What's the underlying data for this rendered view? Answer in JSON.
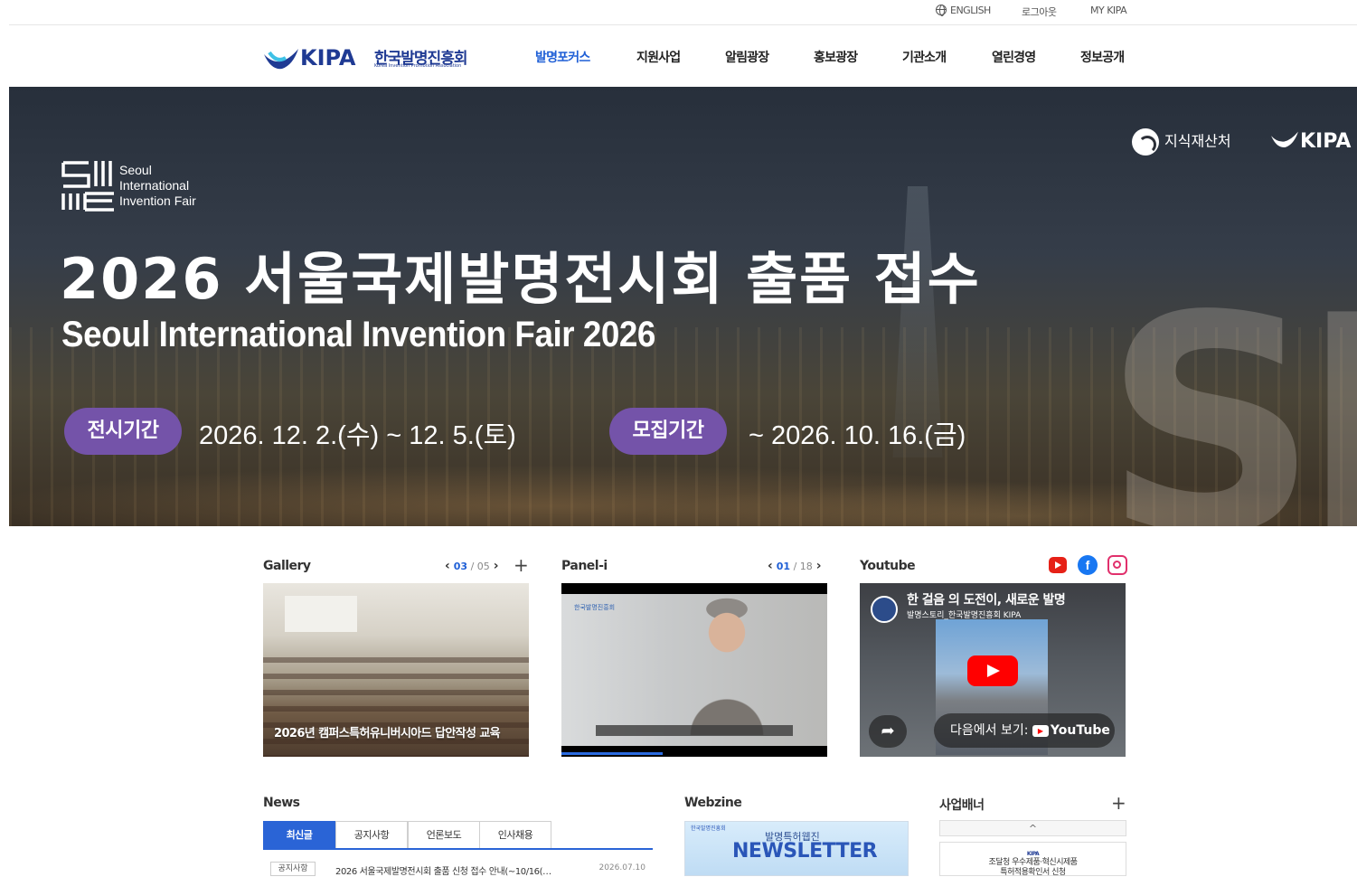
{
  "utility": {
    "english": "ENGLISH",
    "logout": "로그아웃",
    "mykipa": "MY KIPA"
  },
  "logo": {
    "mark": "KIPA",
    "korean": "한국발명진흥회",
    "english": "Korea Invention Promotion Association"
  },
  "gnb": [
    {
      "label": "발명포커스",
      "active": true
    },
    {
      "label": "지원사업"
    },
    {
      "label": "알림광장"
    },
    {
      "label": "홍보광장"
    },
    {
      "label": "기관소개"
    },
    {
      "label": "열린경영"
    },
    {
      "label": "정보공개"
    }
  ],
  "hero": {
    "fair_name_lines": [
      "Seoul",
      "International",
      "Invention Fair"
    ],
    "title": "2026 서울국제발명전시회 출품 접수",
    "subtitle": "Seoul International Invention Fair 2026",
    "period1_label": "전시기간",
    "period1_value": "2026. 12. 2.(수) ~ 12. 5.(토)",
    "period2_label": "모집기간",
    "period2_value": "~ 2026. 10. 16.(금)",
    "partner1": "지식재산처",
    "partner2": "KIPA",
    "accent": "#7453a9"
  },
  "gallery": {
    "title": "Gallery",
    "current": "03",
    "total": "05",
    "caption": "2026년 캠퍼스특허유니버시아드 답안작성 교육"
  },
  "panel": {
    "title": "Panel-i",
    "current": "01",
    "total": "18",
    "brand": "한국발명진흥회"
  },
  "youtube": {
    "title": "Youtube",
    "video_title": "한 걸음 의 도전이, 새로운 발명",
    "channel": "발명스토리_한국발명진흥회 KIPA",
    "watch_label": "다음에서 보기:",
    "watch_brand": "YouTube"
  },
  "news": {
    "title": "News",
    "tabs": [
      "최신글",
      "공지사항",
      "언론보도",
      "인사채용"
    ],
    "active_tab": "최신글",
    "items": [
      {
        "category": "공지사항",
        "title": "2026 서울국제발명전시회 출품 신청 접수 안내(~10/16(…",
        "date": "2026.07.10"
      }
    ]
  },
  "webzine": {
    "title": "Webzine",
    "head": "발명특허웹진",
    "big": "NEWSLETTER"
  },
  "banner": {
    "title": "사업배너",
    "up_arrow": "^",
    "kipa": "KIPA",
    "line1": "조달청 우수제품·혁신시제품",
    "line2": "특허적용확인서 신청"
  },
  "colors": {
    "brand": "#1f3a93",
    "active_nav": "#1f5fd6",
    "tab_active": "#2a64d6"
  }
}
